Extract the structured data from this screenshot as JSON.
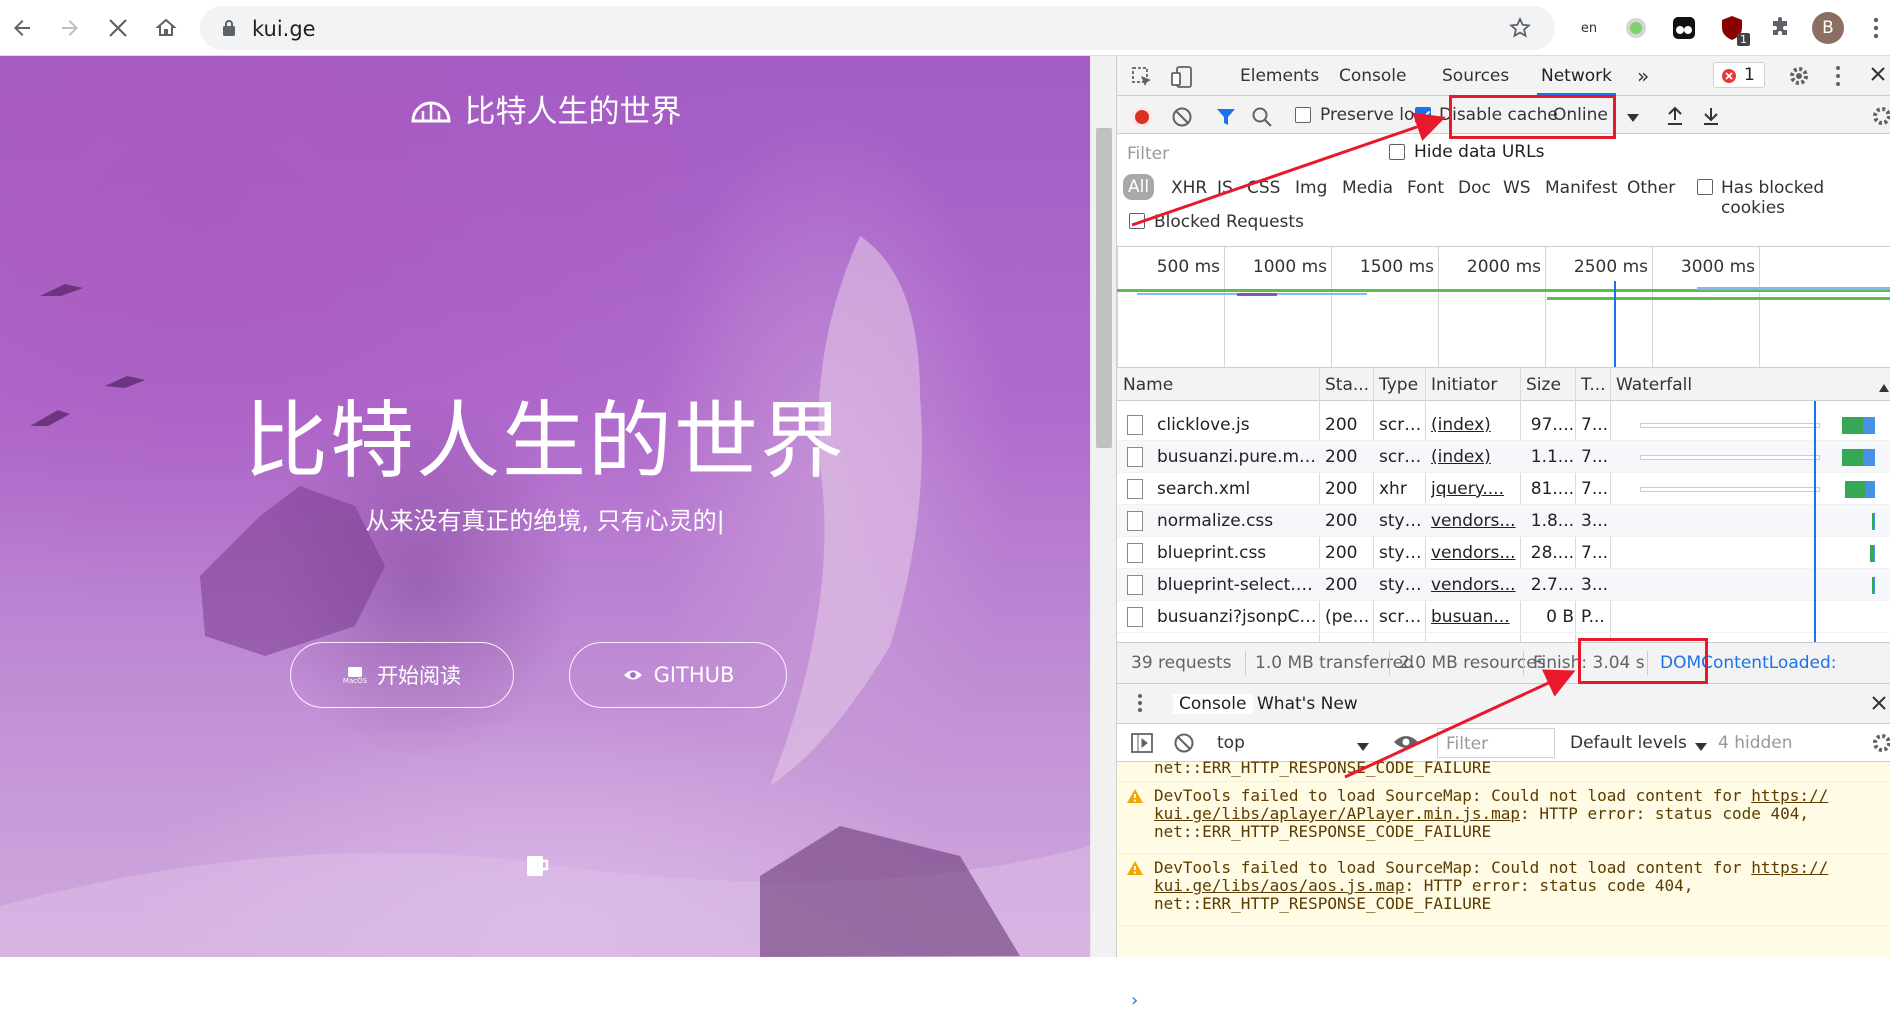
{
  "browser": {
    "url": "kui.ge",
    "profile_initial": "B",
    "extension_badge": "1",
    "translate_label": "en"
  },
  "site": {
    "header_title": "比特人生的世界",
    "hero_title": "比特人生的世界",
    "hero_subtitle": "从来没有真正的绝境, 只有心灵的|",
    "read_button": "开始阅读",
    "read_button_icon_text": "MacOS",
    "github_button": "GITHUB"
  },
  "devtools": {
    "tabs": [
      "Elements",
      "Console",
      "Sources",
      "Network"
    ],
    "error_count": "1",
    "toolbar": {
      "preserve_log": "Preserve log",
      "disable_cache": "Disable cache",
      "throttling": "Online"
    },
    "filter_placeholder": "Filter",
    "hide_data_urls": "Hide data URLs",
    "types": [
      "All",
      "XHR",
      "JS",
      "CSS",
      "Img",
      "Media",
      "Font",
      "Doc",
      "WS",
      "Manifest",
      "Other"
    ],
    "has_blocked_cookies": "Has blocked cookies",
    "blocked_requests": "Blocked Requests",
    "timeline_ticks": [
      "500 ms",
      "1000 ms",
      "1500 ms",
      "2000 ms",
      "2500 ms",
      "3000 ms"
    ],
    "columns": [
      "Name",
      "Sta...",
      "Type",
      "Initiator",
      "Size",
      "T...",
      "Waterfall"
    ],
    "rows": [
      {
        "name": "clicklove.js",
        "status": "200",
        "type": "scri...",
        "initiator": "(index)",
        "size": "97....",
        "time": "7...",
        "wf_fill": 0.55
      },
      {
        "name": "busuanzi.pure.min...",
        "status": "200",
        "type": "scri...",
        "initiator": "(index)",
        "size": "1.1...",
        "time": "7...",
        "wf_fill": 0.55
      },
      {
        "name": "search.xml",
        "status": "200",
        "type": "xhr",
        "initiator": "jquery....",
        "size": "81....",
        "time": "7...",
        "wf_fill": 0.5
      },
      {
        "name": "normalize.css",
        "status": "200",
        "type": "styl...",
        "initiator": "vendors...",
        "size": "1.8...",
        "time": "3...",
        "wf_fill": 0.05
      },
      {
        "name": "blueprint.css",
        "status": "200",
        "type": "styl...",
        "initiator": "vendors...",
        "size": "28....",
        "time": "7...",
        "wf_fill": 0.08
      },
      {
        "name": "blueprint-select.css",
        "status": "200",
        "type": "styl...",
        "initiator": "vendors...",
        "size": "2.7...",
        "time": "3...",
        "wf_fill": 0.05
      },
      {
        "name": "busuanzi?jsonpCa...",
        "status": "(pe...",
        "type": "scri...",
        "initiator": "busuan...",
        "size": "0 B",
        "time": "P...",
        "wf_fill": 0
      }
    ],
    "summary": {
      "requests": "39 requests",
      "transferred": "1.0 MB transferred",
      "resources": "2.0 MB resources",
      "finish": "Finish: 3.04 s",
      "dom_loaded": "DOMContentLoaded:"
    },
    "drawer_tabs": [
      "Console",
      "What's New"
    ],
    "console_toolbar": {
      "context": "top",
      "filter_placeholder": "Filter",
      "levels": "Default levels",
      "hidden": "4 hidden"
    },
    "messages": {
      "partial": "net::ERR_HTTP_RESPONSE_CODE_FAILURE",
      "m1_line1_text": "DevTools failed to load SourceMap: Could not load content for ",
      "m1_line1_link": "https://",
      "m1_line2_link": "kui.ge/libs/aplayer/APlayer.min.js.map",
      "m1_line2_text": ": HTTP error: status code 404,",
      "m1_line3": "net::ERR_HTTP_RESPONSE_CODE_FAILURE",
      "m2_line1_text": "DevTools failed to load SourceMap: Could not load content for ",
      "m2_line1_link": "https://",
      "m2_line2_link": "kui.ge/libs/aos/aos.js.map",
      "m2_line2_text": ": HTTP error: status code 404,",
      "m2_line3": "net::ERR_HTTP_RESPONSE_CODE_FAILURE"
    }
  },
  "colors": {
    "annotation_red": "#e8192c",
    "accent_blue": "#1a73e8",
    "purple_bg": "#a35cc6"
  }
}
